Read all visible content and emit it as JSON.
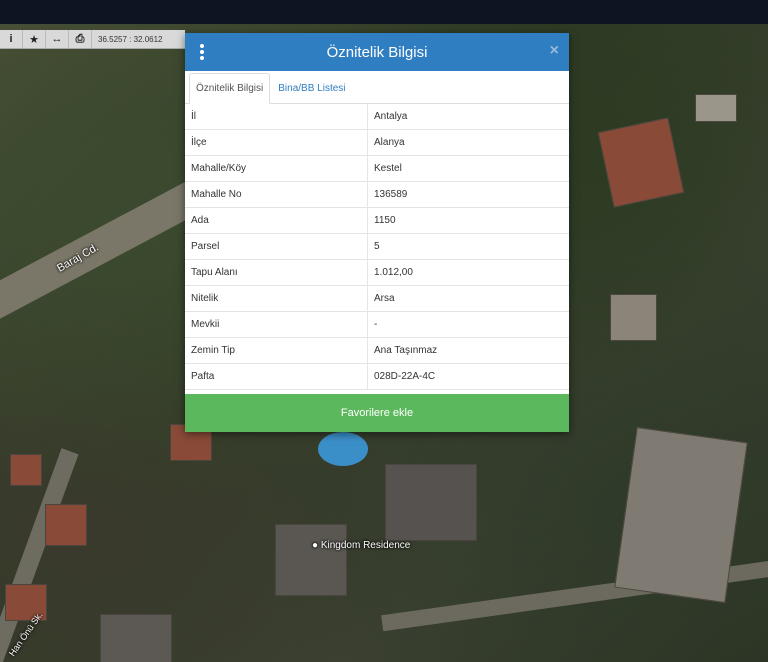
{
  "toolbar": {
    "info_icon": "info-icon",
    "star_icon": "star-icon",
    "measure_icon": "measure-icon",
    "print_icon": "print-icon",
    "coords": "36.5257 : 32.0612"
  },
  "map": {
    "road_label": "Baraj Cd.",
    "poi_label": "Kingdom Residence",
    "street_label": "Han Önü Sk."
  },
  "modal": {
    "title": "Öznitelik Bilgisi",
    "tabs": [
      {
        "label": "Öznitelik Bilgisi",
        "active": true
      },
      {
        "label": "Bina/BB Listesi",
        "active": false
      }
    ],
    "rows": [
      {
        "key": "İl",
        "value": "Antalya"
      },
      {
        "key": "İlçe",
        "value": "Alanya"
      },
      {
        "key": "Mahalle/Köy",
        "value": "Kestel"
      },
      {
        "key": "Mahalle No",
        "value": "136589"
      },
      {
        "key": "Ada",
        "value": "1150"
      },
      {
        "key": "Parsel",
        "value": "5"
      },
      {
        "key": "Tapu Alanı",
        "value": "1.012,00"
      },
      {
        "key": "Nitelik",
        "value": "Arsa"
      },
      {
        "key": "Mevkii",
        "value": "-"
      },
      {
        "key": "Zemin Tip",
        "value": "Ana Taşınmaz"
      },
      {
        "key": "Pafta",
        "value": "028D-22A-4C"
      }
    ],
    "fav_label": "Favorilere ekle"
  },
  "colors": {
    "header": "#2e7ec1",
    "fav_button": "#5cb85c"
  }
}
